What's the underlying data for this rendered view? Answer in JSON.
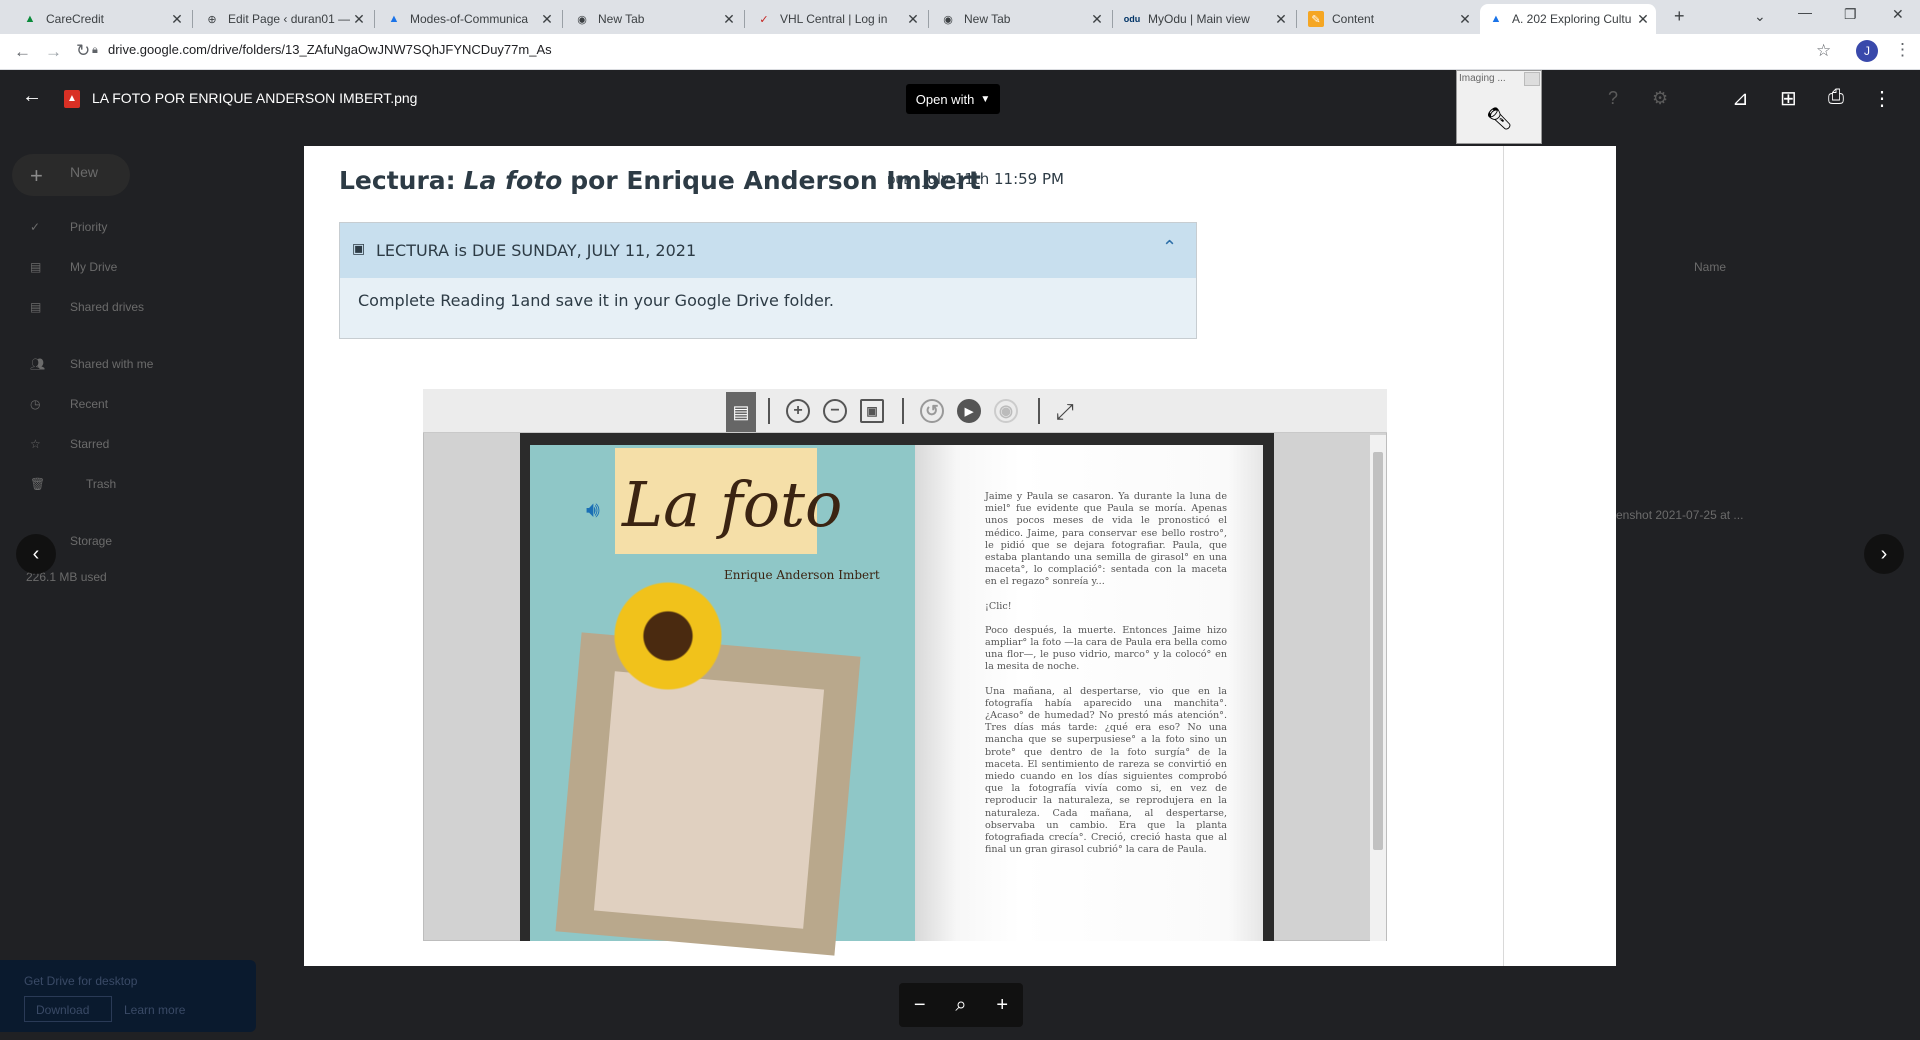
{
  "browser": {
    "tabs": [
      {
        "title": "CareCredit",
        "active": false
      },
      {
        "title": "Edit Page ‹ duran01 —",
        "active": false
      },
      {
        "title": "Modes-of-Communica",
        "active": false
      },
      {
        "title": "New Tab",
        "active": false
      },
      {
        "title": "VHL Central | Log in",
        "active": false
      },
      {
        "title": "New Tab",
        "active": false
      },
      {
        "title": "MyOdu | Main view",
        "active": false
      },
      {
        "title": "Content",
        "active": false
      },
      {
        "title": "A. 202 Exploring Cultu",
        "active": true
      }
    ],
    "url": "drive.google.com/drive/folders/13_ZAfuNgaOwJNW7SQhJFYNCDuy77m_As",
    "profile_initial": "J"
  },
  "viewer": {
    "file_name": "LA FOTO POR ENRIQUE ANDERSON IMBERT.png",
    "open_with_label": "Open with",
    "imaging_label": "Imaging ..."
  },
  "drive_background": {
    "new_label": "New",
    "nav": [
      "Priority",
      "My Drive",
      "Shared drives",
      "Shared with me",
      "Recent",
      "Starred",
      "Trash",
      "Storage"
    ],
    "storage_used": "226.1 MB used",
    "get_drive_label": "Get Drive for desktop",
    "download_label": "Download",
    "learn_more_label": "Learn more",
    "name_header": "Name",
    "file_snippet": "enshot 2021-07-25 at ..."
  },
  "assignment": {
    "title_prefix": "Lectura:",
    "title_italic": "La foto",
    "title_suffix": "por Enrique Anderson Imbert",
    "due_label": "DUE",
    "due_date": "July 11th 11:59 PM",
    "panel_title": "LECTURA is DUE SUNDAY, JULY 11, 2021",
    "panel_body": "Complete Reading 1and save it in your Google Drive folder."
  },
  "book": {
    "title": "La foto",
    "author": "Enrique Anderson Imbert",
    "paragraphs": [
      "Jaime y Paula se casaron. Ya durante la luna de miel° fue evidente que Paula se moría. Apenas unos pocos meses de vida le pronosticó el médico. Jaime, para conservar ese bello rostro°, le pidió que se dejara fotografiar. Paula, que estaba plantando una semilla de girasol° en una maceta°, lo complació°: sentada con la maceta en el regazo° sonreía y...",
      "¡Clic!",
      "Poco después, la muerte. Entonces Jaime hizo ampliar° la foto —la cara de Paula era bella como una flor—, le puso vidrio, marco° y la colocó° en la mesita de noche.",
      "Una mañana, al despertarse, vio que en la fotografía había aparecido una manchita°. ¿Acaso° de humedad? No prestó más atención°. Tres días más tarde: ¿qué era eso? No una mancha que se superpusiese° a la foto sino un brote° que dentro de la foto surgía° de la maceta. El sentimiento de rareza se convirtió en miedo cuando en los días siguientes comprobó que la fotografía vivía como si, en vez de reproducir la naturaleza, se reprodujera en la naturaleza. Cada mañana, al despertarse, observaba un cambio. Era que la planta fotografiada crecía°. Creció, creció hasta que al final un gran girasol cubrió° la cara de Paula."
    ]
  },
  "colors": {
    "accent": "#1a73e8",
    "panel_head": "#c8dfee",
    "panel_body": "#e7f0f6",
    "text": "#2d3b45"
  }
}
